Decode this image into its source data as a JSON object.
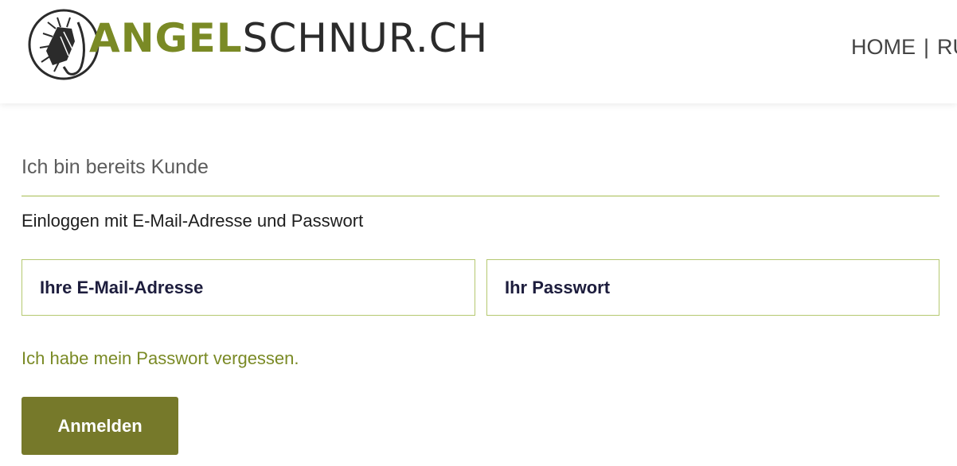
{
  "header": {
    "logo": {
      "text_green": "ANGEL",
      "text_dark": "SCHNUR.CH",
      "emblem_icon": "fishing-fly-icon"
    },
    "nav": {
      "home": "HOME",
      "separator": "|",
      "next_partial": "RU"
    }
  },
  "login": {
    "section_title": "Ich bin bereits Kunde",
    "subtitle": "Einloggen mit E-Mail-Adresse und Passwort",
    "email": {
      "value": "",
      "placeholder": "Ihre E-Mail-Adresse"
    },
    "password": {
      "value": "",
      "placeholder": "Ihr Passwort"
    },
    "forgot_link": "Ich habe mein Passwort vergessen.",
    "submit_label": "Anmelden"
  },
  "colors": {
    "brand_green": "#7a8a25",
    "button_olive": "#76792a",
    "border_green": "#b5c870",
    "divider_green": "#a6bd52",
    "field_text": "#1d1d3d"
  }
}
